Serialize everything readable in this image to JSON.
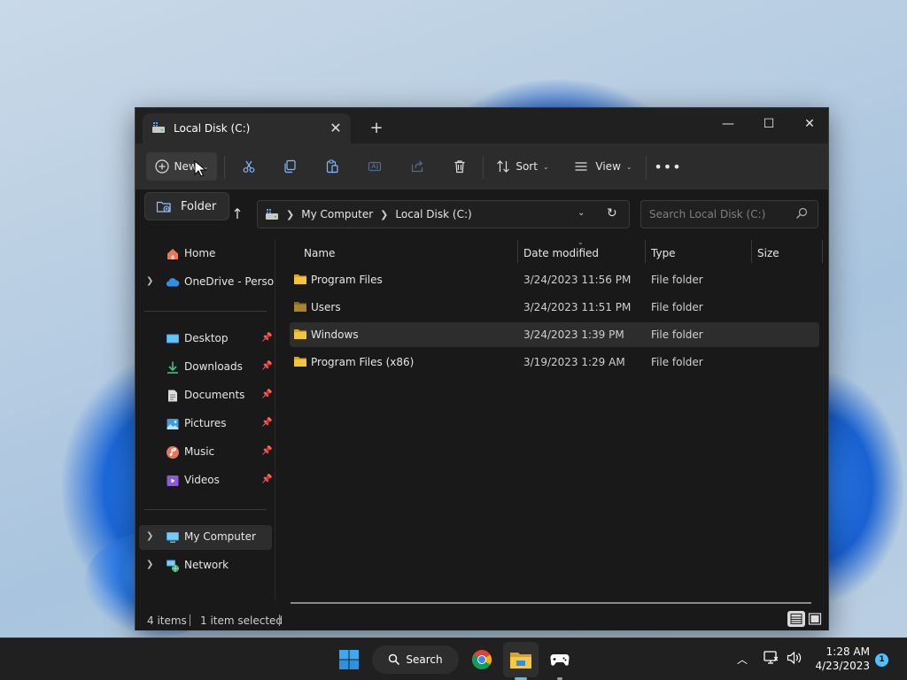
{
  "window": {
    "tab_title": "Local Disk (C:)",
    "new_tab": "+",
    "controls": {
      "minimize": "—",
      "maximize": "☐",
      "close": "✕"
    }
  },
  "toolbar": {
    "new_label": "New",
    "sort_label": "Sort",
    "view_label": "View",
    "more_label": "•••",
    "icons": [
      "plus-circle-icon",
      "cut-icon",
      "copy-icon",
      "paste-icon",
      "rename-icon",
      "share-icon",
      "delete-icon",
      "sort-icon",
      "view-icon",
      "more-icon"
    ]
  },
  "new_menu": {
    "folder_label": "Folder"
  },
  "address": {
    "crumbs": [
      "My Computer",
      "Local Disk (C:)"
    ],
    "search_placeholder": "Search Local Disk (C:)"
  },
  "sidebar": {
    "items": [
      {
        "label": "Home"
      },
      {
        "label": "OneDrive - Personal"
      },
      {
        "label": "Desktop"
      },
      {
        "label": "Downloads"
      },
      {
        "label": "Documents"
      },
      {
        "label": "Pictures"
      },
      {
        "label": "Music"
      },
      {
        "label": "Videos"
      },
      {
        "label": "My Computer"
      },
      {
        "label": "Network"
      }
    ]
  },
  "columns": {
    "name": "Name",
    "date": "Date modified",
    "type": "Type",
    "size": "Size"
  },
  "files": [
    {
      "name": "Program Files",
      "date": "3/24/2023 11:56 PM",
      "type": "File folder"
    },
    {
      "name": "Users",
      "date": "3/24/2023 11:51 PM",
      "type": "File folder"
    },
    {
      "name": "Windows",
      "date": "3/24/2023 1:39 PM",
      "type": "File folder"
    },
    {
      "name": "Program Files (x86)",
      "date": "3/19/2023 1:29 AM",
      "type": "File folder"
    }
  ],
  "status": {
    "count": "4 items",
    "selected": "1 item selected"
  },
  "taskbar": {
    "search_label": "Search",
    "time": "1:28 AM",
    "date": "4/23/2023",
    "notifications": "1"
  },
  "colors": {
    "accent": "#4cc2ff",
    "folder": "#f3c53f",
    "taskbar": "#202020",
    "window": "#191919"
  }
}
